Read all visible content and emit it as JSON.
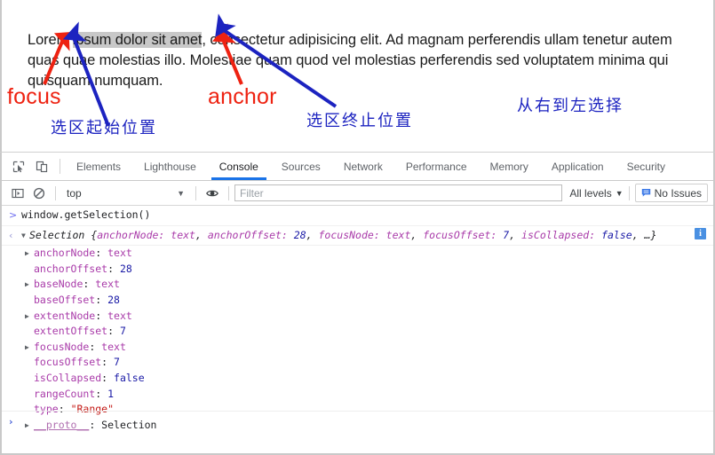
{
  "page": {
    "paragraph_parts": [
      {
        "text": "Lorem ",
        "selected": false
      },
      {
        "text": "ipsum dolor sit amet",
        "selected": true
      },
      {
        "text": ", consectetur adipisicing elit. Ad magnam perferendis ullam tenetur autem quas quae molestias illo. Molestiae quam quod vel molestias perferendis sed voluptatem minima qui quisquam numquam.",
        "selected": false
      }
    ],
    "selection_highlight_color": "#c8c8c8"
  },
  "annotations": {
    "red_color": "#ee2211",
    "blue_color": "#1c23c0",
    "focus_label": "focus",
    "anchor_label": "anchor",
    "selection_start_label": "选区起始位置",
    "selection_end_label": "选区终止位置",
    "direction_label": "从右到左选择"
  },
  "devtools": {
    "tabs": [
      {
        "label": "Elements",
        "active": false
      },
      {
        "label": "Lighthouse",
        "active": false
      },
      {
        "label": "Console",
        "active": true
      },
      {
        "label": "Sources",
        "active": false
      },
      {
        "label": "Network",
        "active": false
      },
      {
        "label": "Performance",
        "active": false
      },
      {
        "label": "Memory",
        "active": false
      },
      {
        "label": "Application",
        "active": false
      },
      {
        "label": "Security",
        "active": false
      }
    ],
    "active_tab_color": "#1a73e8",
    "icons": {
      "inspect": "inspect-element-icon",
      "device": "device-toolbar-icon",
      "sidebar": "console-sidebar-icon",
      "clear": "clear-console-icon",
      "eye": "live-expression-eye-icon",
      "issues": "issues-bubble-icon"
    },
    "console_toolbar": {
      "context": "top",
      "context_caret": "▼",
      "filter_placeholder": "Filter",
      "filter_value": "",
      "levels_label": "All levels",
      "levels_caret": "▼",
      "issues_label": "No Issues"
    },
    "console": {
      "input_gutter": ">",
      "output_gutter": "‹",
      "command": "window.getSelection()",
      "result_summary": {
        "prefix": "Selection ",
        "open": "{",
        "items": [
          {
            "key": "anchorNode: ",
            "value": "text",
            "vtype": "node"
          },
          {
            "key": "anchorOffset: ",
            "value": "28",
            "vtype": "num"
          },
          {
            "key": "focusNode: ",
            "value": "text",
            "vtype": "node"
          },
          {
            "key": "focusOffset: ",
            "value": "7",
            "vtype": "num"
          },
          {
            "key": "isCollapsed: ",
            "value": "false",
            "vtype": "bool"
          }
        ],
        "ellipsis": ", …",
        "close": "}"
      },
      "properties": [
        {
          "expandable": true,
          "key": "anchorNode",
          "sep": ": ",
          "value": "text",
          "vtype": "node"
        },
        {
          "expandable": false,
          "key": "anchorOffset",
          "sep": ": ",
          "value": "28",
          "vtype": "num"
        },
        {
          "expandable": true,
          "key": "baseNode",
          "sep": ": ",
          "value": "text",
          "vtype": "node"
        },
        {
          "expandable": false,
          "key": "baseOffset",
          "sep": ": ",
          "value": "28",
          "vtype": "num"
        },
        {
          "expandable": true,
          "key": "extentNode",
          "sep": ": ",
          "value": "text",
          "vtype": "node"
        },
        {
          "expandable": false,
          "key": "extentOffset",
          "sep": ": ",
          "value": "7",
          "vtype": "num"
        },
        {
          "expandable": true,
          "key": "focusNode",
          "sep": ": ",
          "value": "text",
          "vtype": "node"
        },
        {
          "expandable": false,
          "key": "focusOffset",
          "sep": ": ",
          "value": "7",
          "vtype": "num"
        },
        {
          "expandable": false,
          "key": "isCollapsed",
          "sep": ": ",
          "value": "false",
          "vtype": "bool"
        },
        {
          "expandable": false,
          "key": "rangeCount",
          "sep": ": ",
          "value": "1",
          "vtype": "num"
        },
        {
          "expandable": false,
          "key": "type",
          "sep": ": ",
          "value": "\"Range\"",
          "vtype": "str"
        },
        {
          "expandable": true,
          "key": "__proto__",
          "sep": ": ",
          "value": "Selection",
          "vtype": "plain",
          "proto": true
        }
      ],
      "info_badge": "i",
      "prompt_gutter": "›"
    }
  }
}
